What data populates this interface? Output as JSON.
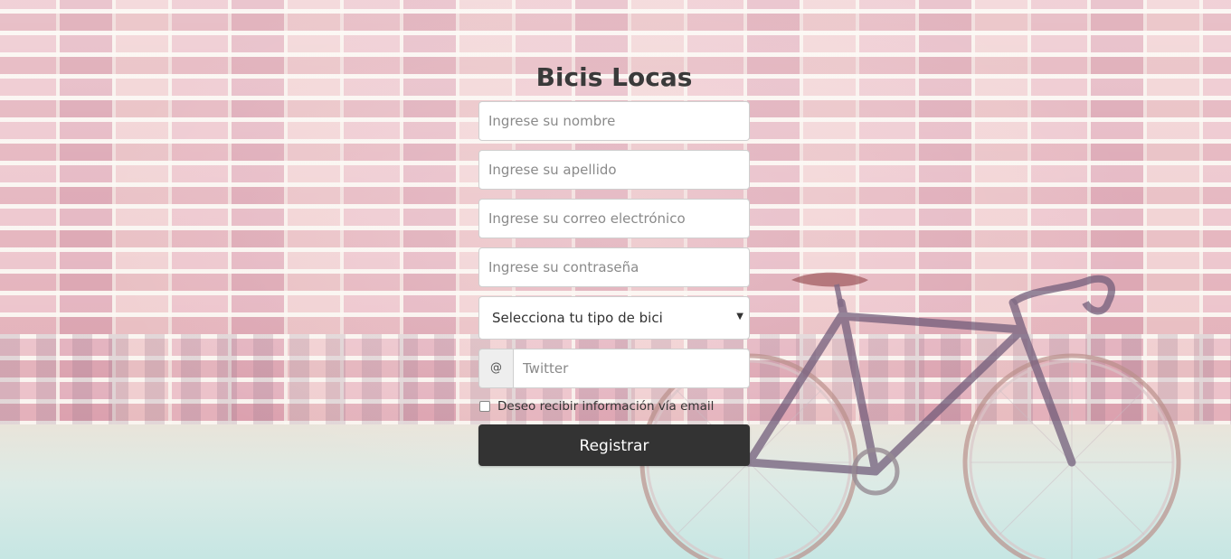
{
  "page": {
    "title": "Bicis Locas"
  },
  "form": {
    "nombre_placeholder": "Ingrese su nombre",
    "apellido_placeholder": "Ingrese su apellido",
    "correo_placeholder": "Ingrese su correo electrónico",
    "contrasena_placeholder": "Ingrese su contraseña",
    "bike_type": {
      "selected": "Selecciona tu tipo de bici"
    },
    "twitter": {
      "addon": "@",
      "placeholder": "Twitter"
    },
    "newsletter": {
      "label": "Deseo recibir información vía email",
      "checked": false
    },
    "submit_label": "Registrar"
  },
  "colors": {
    "button_bg": "#333333",
    "title_text": "#3a3a3a",
    "field_border": "#cfcfcf"
  },
  "background": {
    "scene": "brick-wall-with-bicycle"
  }
}
